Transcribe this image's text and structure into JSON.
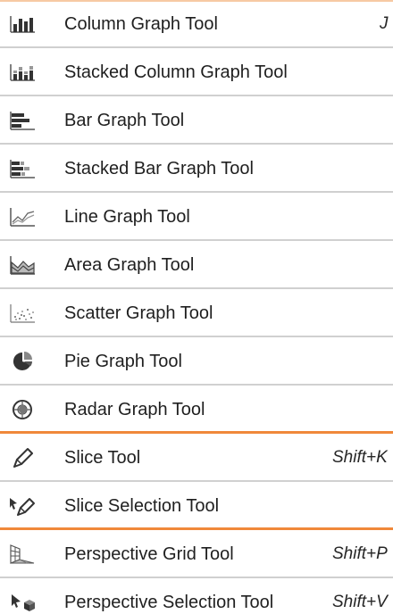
{
  "menu": {
    "items": [
      {
        "label": "Column Graph Tool",
        "shortcut": "J",
        "icon": "column-graph-icon"
      },
      {
        "label": "Stacked Column Graph Tool",
        "shortcut": "",
        "icon": "stacked-column-graph-icon"
      },
      {
        "label": "Bar Graph Tool",
        "shortcut": "",
        "icon": "bar-graph-icon"
      },
      {
        "label": "Stacked Bar Graph Tool",
        "shortcut": "",
        "icon": "stacked-bar-graph-icon"
      },
      {
        "label": "Line Graph Tool",
        "shortcut": "",
        "icon": "line-graph-icon"
      },
      {
        "label": "Area Graph Tool",
        "shortcut": "",
        "icon": "area-graph-icon"
      },
      {
        "label": "Scatter Graph Tool",
        "shortcut": "",
        "icon": "scatter-graph-icon"
      },
      {
        "label": "Pie Graph Tool",
        "shortcut": "",
        "icon": "pie-graph-icon"
      },
      {
        "label": "Radar Graph Tool",
        "shortcut": "",
        "icon": "radar-graph-icon"
      },
      {
        "label": "Slice Tool",
        "shortcut": "Shift+K",
        "icon": "slice-icon"
      },
      {
        "label": "Slice Selection Tool",
        "shortcut": "",
        "icon": "slice-selection-icon"
      },
      {
        "label": "Perspective Grid Tool",
        "shortcut": "Shift+P",
        "icon": "perspective-grid-icon"
      },
      {
        "label": "Perspective Selection Tool",
        "shortcut": "Shift+V",
        "icon": "perspective-selection-icon"
      }
    ]
  },
  "colors": {
    "group_divider": "#f0883a",
    "divider": "#d0d0d0",
    "text": "#1f1f1f"
  }
}
